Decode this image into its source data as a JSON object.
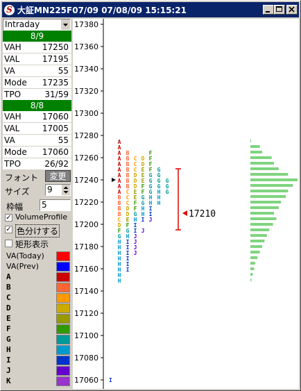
{
  "window": {
    "title": "大証MN225F07/09 07/08/09 15:15:21",
    "icon": "app-logo-icon",
    "buttons": [
      "minimize-icon",
      "maximize-icon",
      "close-icon"
    ]
  },
  "mode_dropdown": {
    "value": "Intraday"
  },
  "day1": {
    "label": "8/9",
    "rows": [
      {
        "key": "VAH",
        "value": "17250"
      },
      {
        "key": "VAL",
        "value": "17195"
      },
      {
        "key": "VA",
        "value": "55"
      },
      {
        "key": "Mode",
        "value": "17235"
      },
      {
        "key": "TPO",
        "value": "31/59"
      }
    ]
  },
  "day2": {
    "label": "8/8",
    "rows": [
      {
        "key": "VAH",
        "value": "17060"
      },
      {
        "key": "VAL",
        "value": "17005"
      },
      {
        "key": "VA",
        "value": "55"
      },
      {
        "key": "Mode",
        "value": "17060"
      },
      {
        "key": "TPO",
        "value": "26/92"
      }
    ]
  },
  "settings": {
    "font_label": "フォント",
    "change_label": "変更",
    "size_label": "サイズ",
    "size_value": "9",
    "frame_label": "枠幅",
    "frame_value": "5",
    "volume_profile_label": "VolumeProfile",
    "volume_profile_checked": true,
    "colorize_label": "色分けする",
    "colorize_checked": true,
    "rect_label": "矩形表示",
    "rect_checked": false
  },
  "legend": [
    {
      "label": "VA(Today)",
      "color": "#ff0000"
    },
    {
      "label": "VA(Prev)",
      "color": "#0000ff"
    },
    {
      "label": "A",
      "color": "#cc0000"
    },
    {
      "label": "B",
      "color": "#ff6633"
    },
    {
      "label": "C",
      "color": "#ff9900"
    },
    {
      "label": "D",
      "color": "#ccaa00"
    },
    {
      "label": "E",
      "color": "#999900"
    },
    {
      "label": "F",
      "color": "#339900"
    },
    {
      "label": "G",
      "color": "#009999"
    },
    {
      "label": "H",
      "color": "#0099cc"
    },
    {
      "label": "I",
      "color": "#0033cc"
    },
    {
      "label": "J",
      "color": "#6600cc"
    },
    {
      "label": "K",
      "color": "#9933cc"
    }
  ],
  "chart_data": {
    "type": "market-profile",
    "y_ticks": [
      17380,
      17360,
      17340,
      17320,
      17300,
      17280,
      17260,
      17240,
      17220,
      17200,
      17180,
      17160,
      17140,
      17120,
      17100,
      17080,
      17060
    ],
    "ylim": [
      17060,
      17385
    ],
    "price_step": 5,
    "tpo_letters": [
      {
        "letter": "A",
        "color": "#cc0000",
        "low": 17230,
        "high": 17275
      },
      {
        "letter": "B",
        "color": "#ff6633",
        "low": 17200,
        "high": 17230
      },
      {
        "letter": "C",
        "color": "#ff9900",
        "low": 17195,
        "high": 17200
      },
      {
        "letter": "D",
        "color": "#ccaa00",
        "low": 17190,
        "high": 17195
      },
      {
        "letter": "E",
        "color": "#999900",
        "low": 17195,
        "high": 17200
      },
      {
        "letter": "F",
        "color": "#339900",
        "low": 17195,
        "high": 17200
      },
      {
        "letter": "G",
        "color": "#009999",
        "low": 17190,
        "high": 17195
      },
      {
        "letter": "H",
        "color": "#0099cc",
        "low": 17150,
        "high": 17190
      },
      {
        "letter": "I",
        "color": "#0033cc",
        "low": 17060,
        "high": 17060
      }
    ],
    "columns": [
      {
        "cells": [
          {
            "p": 17275,
            "l": "A"
          },
          {
            "p": 17270,
            "l": "A"
          },
          {
            "p": 17265,
            "l": "A"
          },
          {
            "p": 17260,
            "l": "A"
          },
          {
            "p": 17255,
            "l": "A"
          },
          {
            "p": 17250,
            "l": "A"
          },
          {
            "p": 17245,
            "l": "A"
          },
          {
            "p": 17240,
            "l": "A"
          },
          {
            "p": 17235,
            "l": "A"
          },
          {
            "p": 17230,
            "l": "A"
          },
          {
            "p": 17225,
            "l": "B"
          },
          {
            "p": 17220,
            "l": "B"
          },
          {
            "p": 17215,
            "l": "B"
          },
          {
            "p": 17210,
            "l": "B"
          },
          {
            "p": 17205,
            "l": "C"
          },
          {
            "p": 17200,
            "l": "D"
          },
          {
            "p": 17195,
            "l": "F"
          },
          {
            "p": 17190,
            "l": "G"
          },
          {
            "p": 17185,
            "l": "H"
          },
          {
            "p": 17180,
            "l": "H"
          },
          {
            "p": 17175,
            "l": "H"
          },
          {
            "p": 17170,
            "l": "H"
          },
          {
            "p": 17165,
            "l": "H"
          },
          {
            "p": 17160,
            "l": "H"
          },
          {
            "p": 17155,
            "l": "H"
          },
          {
            "p": 17150,
            "l": "H"
          }
        ]
      },
      {
        "cells": [
          {
            "p": 17265,
            "l": "B"
          },
          {
            "p": 17260,
            "l": "B"
          },
          {
            "p": 17255,
            "l": "B"
          },
          {
            "p": 17250,
            "l": "B"
          },
          {
            "p": 17245,
            "l": "B"
          },
          {
            "p": 17240,
            "l": "B"
          },
          {
            "p": 17235,
            "l": "B"
          },
          {
            "p": 17230,
            "l": "C"
          },
          {
            "p": 17225,
            "l": "C"
          },
          {
            "p": 17220,
            "l": "C"
          },
          {
            "p": 17215,
            "l": "D"
          },
          {
            "p": 17210,
            "l": "D"
          },
          {
            "p": 17205,
            "l": "E"
          },
          {
            "p": 17200,
            "l": "F"
          },
          {
            "p": 17195,
            "l": "G"
          },
          {
            "p": 17190,
            "l": "H"
          },
          {
            "p": 17185,
            "l": "I"
          },
          {
            "p": 17180,
            "l": "I"
          },
          {
            "p": 17175,
            "l": "I"
          },
          {
            "p": 17170,
            "l": "I"
          },
          {
            "p": 17165,
            "l": "I"
          },
          {
            "p": 17160,
            "l": "I"
          }
        ]
      },
      {
        "cells": [
          {
            "p": 17260,
            "l": "C"
          },
          {
            "p": 17255,
            "l": "C"
          },
          {
            "p": 17250,
            "l": "C"
          },
          {
            "p": 17245,
            "l": "D"
          },
          {
            "p": 17240,
            "l": "D"
          },
          {
            "p": 17235,
            "l": "D"
          },
          {
            "p": 17230,
            "l": "E"
          },
          {
            "p": 17225,
            "l": "E"
          },
          {
            "p": 17220,
            "l": "F"
          },
          {
            "p": 17215,
            "l": "F"
          },
          {
            "p": 17210,
            "l": "G"
          },
          {
            "p": 17205,
            "l": "H"
          },
          {
            "p": 17200,
            "l": "I"
          },
          {
            "p": 17195,
            "l": "I"
          },
          {
            "p": 17190,
            "l": "J"
          },
          {
            "p": 17185,
            "l": "J"
          },
          {
            "p": 17180,
            "l": "J"
          },
          {
            "p": 17175,
            "l": "J"
          }
        ]
      },
      {
        "cells": [
          {
            "p": 17260,
            "l": "D"
          },
          {
            "p": 17255,
            "l": "D"
          },
          {
            "p": 17250,
            "l": "E"
          },
          {
            "p": 17245,
            "l": "E"
          },
          {
            "p": 17240,
            "l": "E"
          },
          {
            "p": 17235,
            "l": "F"
          },
          {
            "p": 17230,
            "l": "F"
          },
          {
            "p": 17225,
            "l": "G"
          },
          {
            "p": 17220,
            "l": "G"
          },
          {
            "p": 17215,
            "l": "H"
          },
          {
            "p": 17210,
            "l": "H"
          },
          {
            "p": 17205,
            "l": "I"
          },
          {
            "p": 17195,
            "l": "J"
          }
        ]
      },
      {
        "cells": [
          {
            "p": 17265,
            "l": "F"
          },
          {
            "p": 17260,
            "l": "F"
          },
          {
            "p": 17255,
            "l": "F"
          },
          {
            "p": 17250,
            "l": "F"
          },
          {
            "p": 17245,
            "l": "G"
          },
          {
            "p": 17240,
            "l": "G"
          },
          {
            "p": 17235,
            "l": "G"
          },
          {
            "p": 17230,
            "l": "G"
          },
          {
            "p": 17225,
            "l": "H"
          },
          {
            "p": 17220,
            "l": "H"
          },
          {
            "p": 17215,
            "l": "I"
          },
          {
            "p": 17210,
            "l": "I"
          },
          {
            "p": 17205,
            "l": "J"
          }
        ]
      },
      {
        "cells": [
          {
            "p": 17250,
            "l": "G"
          },
          {
            "p": 17245,
            "l": "G"
          },
          {
            "p": 17240,
            "l": "G"
          },
          {
            "p": 17235,
            "l": "G"
          },
          {
            "p": 17230,
            "l": "H"
          },
          {
            "p": 17225,
            "l": "H"
          },
          {
            "p": 17220,
            "l": "H"
          }
        ]
      },
      {
        "cells": [
          {
            "p": 17240,
            "l": "G"
          },
          {
            "p": 17235,
            "l": "G"
          },
          {
            "p": 17230,
            "l": "G"
          }
        ]
      }
    ],
    "extra_marks": [
      {
        "p": 17060,
        "l": "I",
        "column": 0
      }
    ],
    "opening_marker_price": 17240,
    "value_area": {
      "high": 17250,
      "low": 17195,
      "color": "#dd0000"
    },
    "last_price": {
      "value": "17210",
      "color": "#dd0000"
    },
    "volume_profile": {
      "color": "#7fd47f",
      "prices": [
        17275,
        17270,
        17265,
        17260,
        17255,
        17250,
        17245,
        17240,
        17235,
        17230,
        17225,
        17220,
        17215,
        17210,
        17205,
        17200,
        17195,
        17190,
        17185,
        17180,
        17175,
        17170,
        17165,
        17160,
        17155,
        17150
      ],
      "values": [
        1,
        20,
        25,
        45,
        50,
        60,
        80,
        100,
        90,
        80,
        75,
        65,
        60,
        50,
        55,
        48,
        40,
        35,
        30,
        25,
        20,
        15,
        10,
        8,
        5,
        2
      ]
    }
  }
}
